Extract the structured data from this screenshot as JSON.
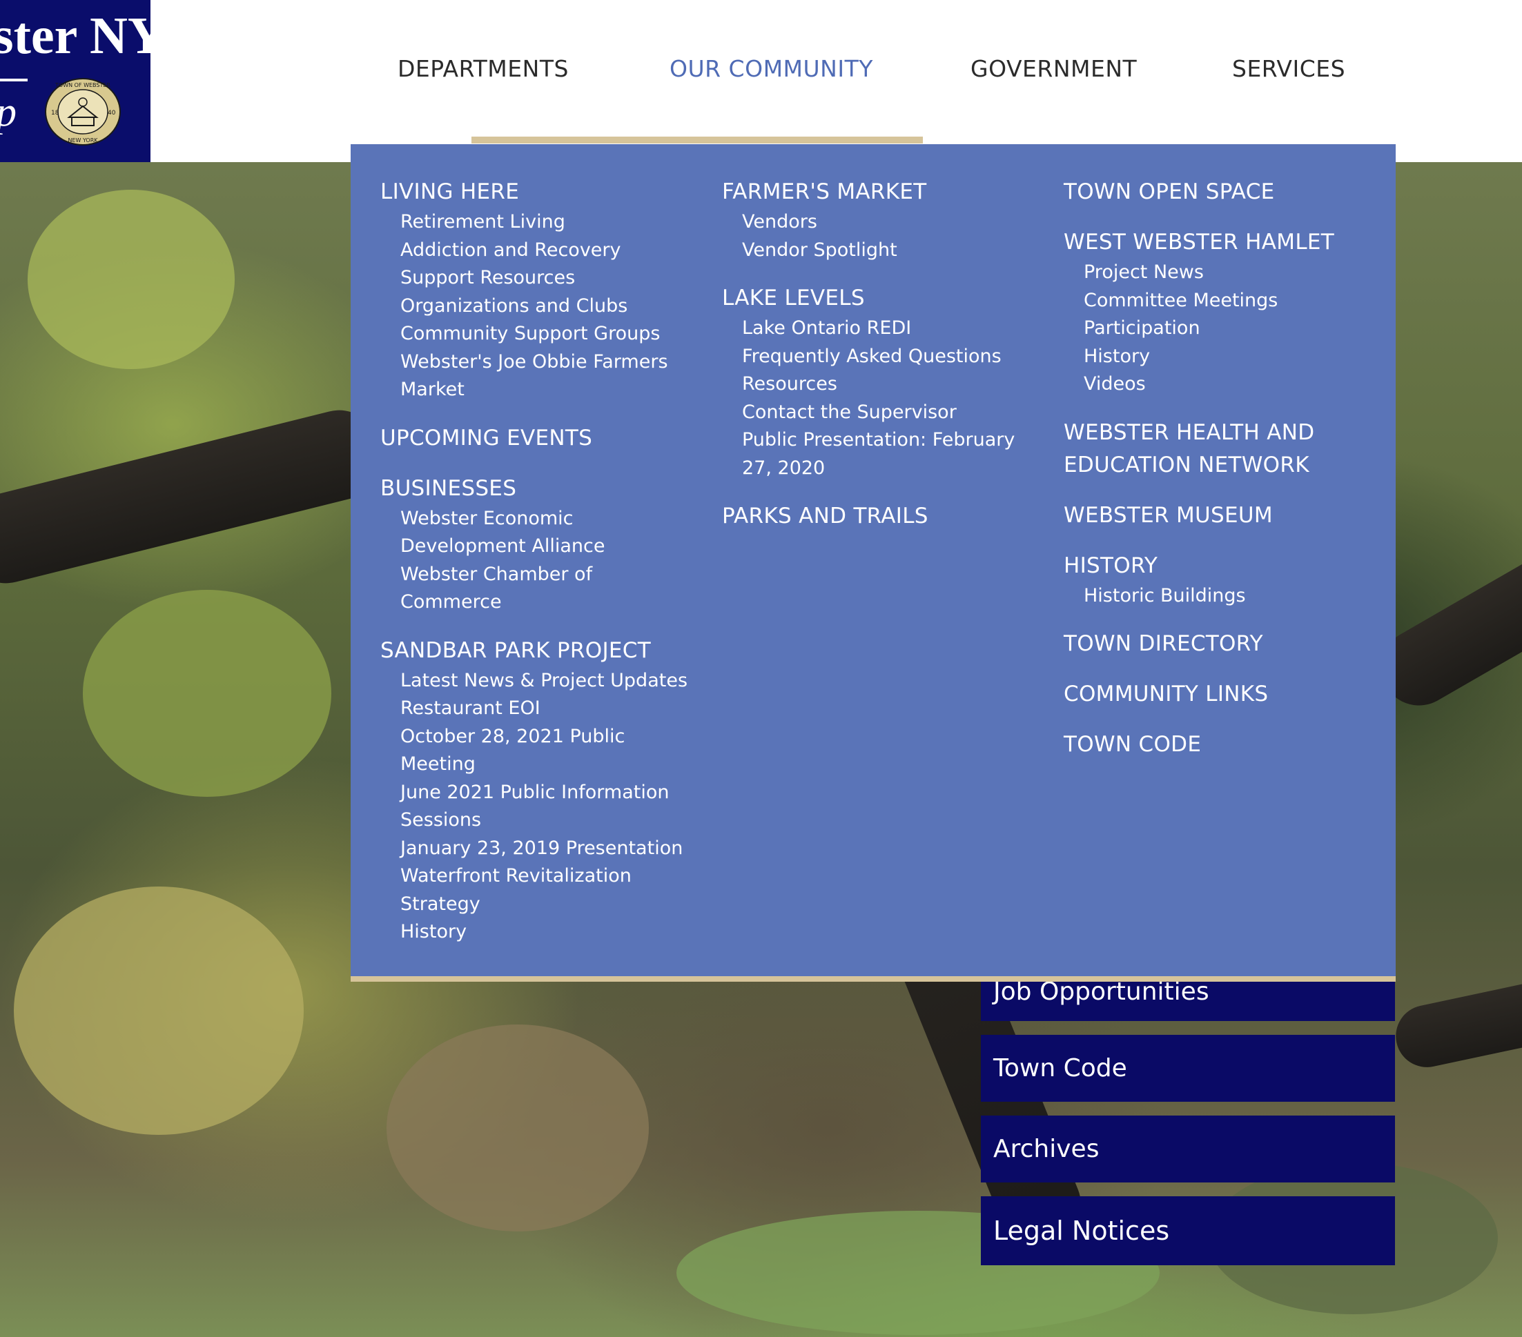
{
  "logo": {
    "text": "ster NY",
    "script": "p",
    "seal_top": "TOWN OF WEBSTER",
    "seal_bottom": "NEW YORK",
    "seal_left": "18",
    "seal_right": "40"
  },
  "nav": {
    "items": [
      {
        "label": "DEPARTMENTS"
      },
      {
        "label": "OUR COMMUNITY"
      },
      {
        "label": "GOVERNMENT"
      },
      {
        "label": "SERVICES"
      }
    ]
  },
  "quick_links": [
    {
      "label": "Job Opportunities"
    },
    {
      "label": "Town Code"
    },
    {
      "label": "Archives"
    },
    {
      "label": "Legal Notices"
    }
  ],
  "mega_menu": {
    "columns": [
      [
        {
          "heading": "LIVING HERE",
          "items": [
            "Retirement Living",
            "Addiction and Recovery",
            "Support Resources",
            "Organizations and Clubs",
            "Community Support Groups",
            "Webster's Joe Obbie Farmers",
            "Market"
          ]
        },
        {
          "heading": "UPCOMING EVENTS",
          "items": []
        },
        {
          "heading": "BUSINESSES",
          "items": [
            "Webster Economic",
            "Development Alliance",
            "Webster Chamber of",
            "Commerce"
          ]
        },
        {
          "heading": "SANDBAR PARK PROJECT",
          "items": [
            "Latest News & Project Updates",
            "Restaurant EOI",
            "October 28, 2021 Public",
            "Meeting",
            "June 2021 Public Information",
            "Sessions",
            "January 23, 2019 Presentation",
            "Waterfront Revitalization",
            "Strategy",
            "History"
          ]
        }
      ],
      [
        {
          "heading": "FARMER'S MARKET",
          "items": [
            "Vendors",
            "Vendor Spotlight"
          ]
        },
        {
          "heading": "LAKE LEVELS",
          "items": [
            "Lake Ontario REDI",
            "Frequently Asked Questions",
            "Resources",
            "Contact the Supervisor",
            "Public Presentation: February",
            "27, 2020"
          ]
        },
        {
          "heading": "PARKS AND TRAILS",
          "items": []
        }
      ],
      [
        {
          "heading": "TOWN OPEN SPACE",
          "items": []
        },
        {
          "heading": "WEST WEBSTER HAMLET",
          "items": [
            "Project News",
            "Committee Meetings",
            "Participation",
            "History",
            "Videos"
          ]
        },
        {
          "heading": "WEBSTER HEALTH AND",
          "heading2": "EDUCATION NETWORK",
          "items": []
        },
        {
          "heading": "WEBSTER MUSEUM",
          "items": []
        },
        {
          "heading": "HISTORY",
          "items": [
            "Historic Buildings"
          ]
        },
        {
          "heading": "TOWN DIRECTORY",
          "items": []
        },
        {
          "heading": "COMMUNITY LINKS",
          "items": []
        },
        {
          "heading": "TOWN CODE",
          "items": []
        }
      ]
    ]
  },
  "colors": {
    "logo_bg": "#0a0d6b",
    "nav_active": "#4f6bb5",
    "menu_bg": "#5a74b8",
    "accent_gold": "#d6c49a",
    "quick_link_bg": "#0a0a66"
  }
}
